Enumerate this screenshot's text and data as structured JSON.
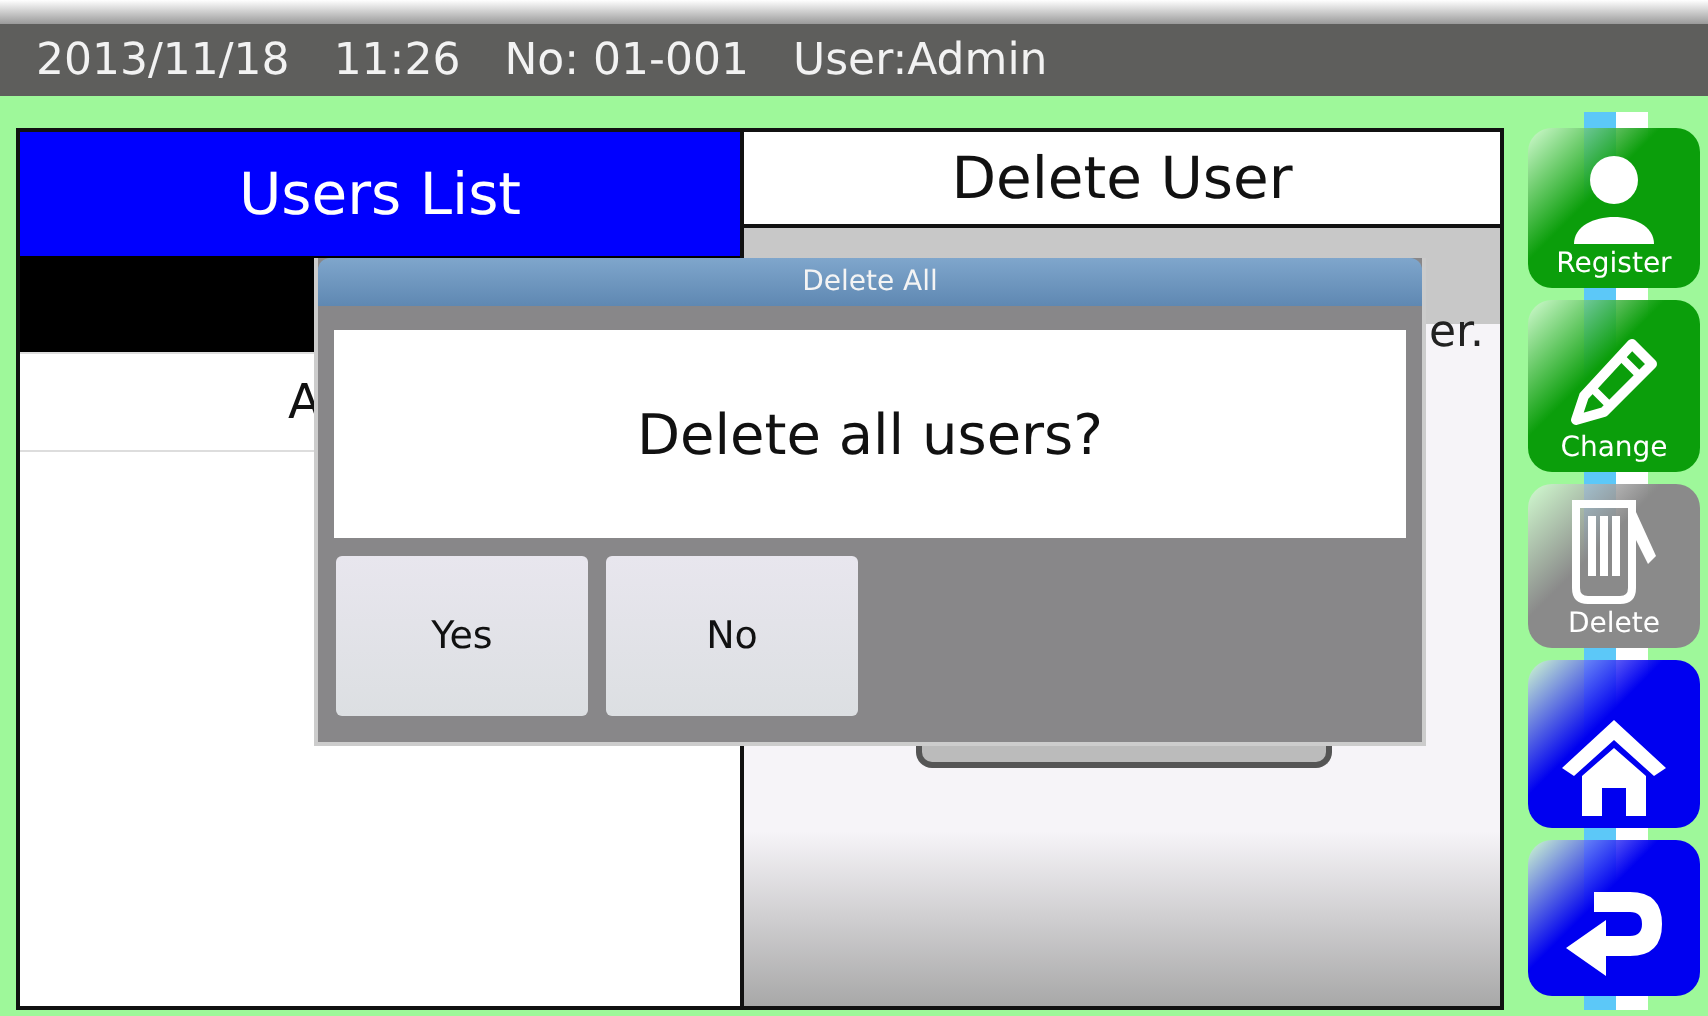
{
  "status_bar": {
    "date": "2013/11/18",
    "time": "11:26",
    "number": "No: 01-001",
    "user": "User:Admin"
  },
  "users_panel": {
    "title": "Users List",
    "rows": [
      {
        "selected": true
      },
      {
        "text": "A",
        "selected": false
      }
    ]
  },
  "delete_panel": {
    "title": "Delete User",
    "text": "er."
  },
  "dialog": {
    "title": "Delete All",
    "message": "Delete all users?",
    "buttons": [
      "Yes",
      "No"
    ]
  },
  "sidebar": [
    {
      "kind": "register",
      "label": "Register",
      "disabled": false
    },
    {
      "kind": "change",
      "label": "Change",
      "disabled": false
    },
    {
      "kind": "delete",
      "label": "Delete",
      "disabled": true
    },
    {
      "kind": "home",
      "disabled": false
    },
    {
      "kind": "back",
      "disabled": false
    }
  ]
}
